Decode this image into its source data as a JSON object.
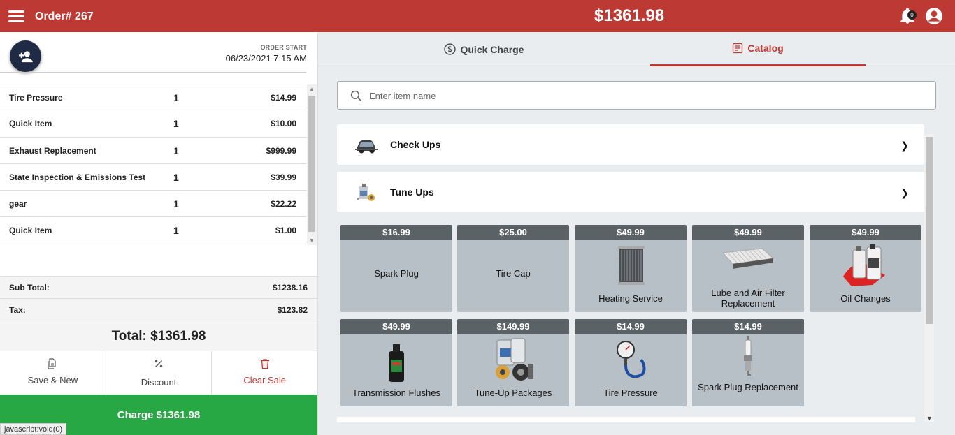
{
  "header": {
    "order_title": "Order# 267",
    "grand_total": "$1361.98",
    "notification_count": "0"
  },
  "order": {
    "start_label": "ORDER START",
    "start_value": "06/23/2021 7:15 AM",
    "items": [
      {
        "name": "Tire Pressure",
        "qty": "1",
        "price": "$14.99"
      },
      {
        "name": "Quick Item",
        "qty": "1",
        "price": "$10.00"
      },
      {
        "name": "Exhaust Replacement",
        "qty": "1",
        "price": "$999.99"
      },
      {
        "name": "State Inspection & Emissions Test",
        "qty": "1",
        "price": "$39.99"
      },
      {
        "name": "gear",
        "qty": "1",
        "price": "$22.22"
      },
      {
        "name": "Quick Item",
        "qty": "1",
        "price": "$1.00"
      }
    ],
    "subtotal_label": "Sub Total:",
    "subtotal_value": "$1238.16",
    "tax_label": "Tax:",
    "tax_value": "$123.82",
    "total_text": "Total: $1361.98"
  },
  "actions": {
    "save_new": "Save & New",
    "discount": "Discount",
    "clear_sale": "Clear Sale",
    "charge": "Charge $1361.98"
  },
  "status_bar": "javascript:void(0)",
  "tabs": {
    "quick_charge": "Quick Charge",
    "catalog": "Catalog"
  },
  "search": {
    "placeholder": "Enter item name"
  },
  "categories": [
    {
      "label": "Check Ups",
      "icon": "car-icon"
    },
    {
      "label": "Tune Ups",
      "icon": "oil-can-icon"
    }
  ],
  "tiles": [
    {
      "price": "$16.99",
      "name": "Spark Plug",
      "icon": null
    },
    {
      "price": "$25.00",
      "name": "Tire Cap",
      "icon": null
    },
    {
      "price": "$49.99",
      "name": "Heating Service",
      "icon": "radiator-icon"
    },
    {
      "price": "$49.99",
      "name": "Lube and Air Filter Replacement",
      "icon": "air-filter-icon"
    },
    {
      "price": "$49.99",
      "name": "Oil Changes",
      "icon": "oil-bottles-icon"
    },
    {
      "price": "$49.99",
      "name": "Transmission Flushes",
      "icon": "fluid-bottle-icon"
    },
    {
      "price": "$149.99",
      "name": "Tune-Up Packages",
      "icon": "tune-up-kit-icon"
    },
    {
      "price": "$14.99",
      "name": "Tire Pressure",
      "icon": "tire-gauge-icon"
    },
    {
      "price": "$14.99",
      "name": "Spark Plug Replacement",
      "icon": "spark-plug-icon"
    }
  ],
  "colors": {
    "brand_red": "#bc3a33",
    "charge_green": "#28a745",
    "navy": "#1f2a44",
    "tile_bg": "#b7c0c6",
    "tile_header": "#5b6266"
  }
}
